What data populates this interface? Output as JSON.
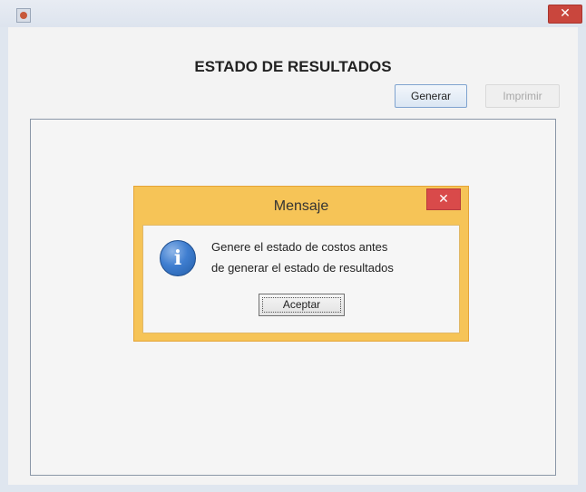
{
  "window": {
    "close_glyph": "✕"
  },
  "report": {
    "title": "ESTADO DE RESULTADOS",
    "generate_label": "Generar",
    "print_label": "Imprimir"
  },
  "dialog": {
    "title": "Mensaje",
    "close_glyph": "✕",
    "icon_glyph": "i",
    "message_line1": "Genere el estado de costos antes",
    "message_line2": "de generar el estado de resultados",
    "ok_label": "Aceptar"
  },
  "icons": {
    "app": "java-app-icon",
    "dialog": "info-icon"
  },
  "colors": {
    "dialog_frame": "#f6c457",
    "close_red": "#d94a4a",
    "info_blue": "#3f7ed0"
  }
}
